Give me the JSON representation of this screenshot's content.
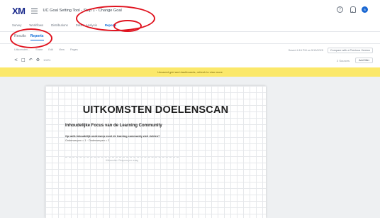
{
  "header": {
    "logo": "XM",
    "title": "UC Goal Setting Tool - Step 1 - Change Goal",
    "help_icon_glyph": "?",
    "avatar_initials": "B"
  },
  "nav_tabs": [
    {
      "label": "Survey",
      "active": false
    },
    {
      "label": "Workflows",
      "active": false
    },
    {
      "label": "Distributions",
      "active": false
    },
    {
      "label": "Data & Analysis",
      "active": false
    },
    {
      "label": "Reports",
      "active": true
    }
  ],
  "sub_tabs": [
    {
      "label": "Results",
      "active": false
    },
    {
      "label": "Reports",
      "active": true
    }
  ],
  "toolbar1": {
    "menus": [
      "Uitkomsten...",
      "Share",
      "Edit",
      "View",
      "Pages"
    ],
    "status": "Saved 4:16 PM on 5/13/2025",
    "compare_button": "Compare with a Previous Version"
  },
  "toolbar2": {
    "zoom": "100%",
    "filter_button": "Add filter",
    "sources": "2 Sources"
  },
  "banner": {
    "text": "Unsaved grid and dashboards, refresh to view more"
  },
  "document": {
    "title": "UITKOMSTEN DOELENSCAN",
    "subtitle": "Inhoudelijke Focus van de Learning Community",
    "question": "Op welk inhoudelijk onderwerp moet de learning community zich richten?",
    "answer": "Onderwerpen = 1 · Onderwerpen = 2",
    "placeholder": "Uitkomsten: Respons per vraag"
  },
  "colors": {
    "brand": "#1a2a8c",
    "accent": "#0b6bd8",
    "banner": "#fbe86a",
    "annotation": "#e0121e"
  }
}
